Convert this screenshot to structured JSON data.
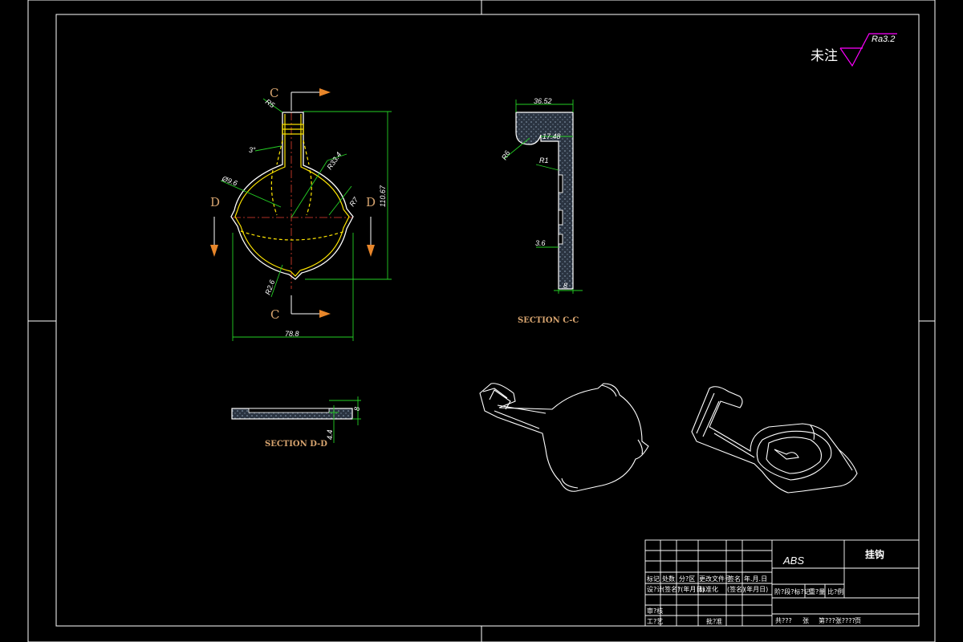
{
  "annotations": {
    "surface_note": "未注",
    "roughness": "Ra3.2"
  },
  "main_view": {
    "section_letters": [
      "C",
      "C",
      "D",
      "D"
    ],
    "dims": {
      "width": "78.8",
      "height": "110.67",
      "r334": "R33.4",
      "r7": "R7",
      "r26": "R2.6",
      "dia": "Ø9.6",
      "angle": "3°",
      "r_top": "R5"
    }
  },
  "section_cc": {
    "label": "SECTION C-C",
    "dims": {
      "width": "36.52",
      "inner": "17.48",
      "r6": "R6",
      "r1": "R1",
      "t36": "3.6",
      "t8": "8"
    }
  },
  "section_dd": {
    "label": "SECTION D-D",
    "dims": {
      "d8": "8",
      "d44": "4.4"
    }
  },
  "title_block": {
    "material": "ABS",
    "part_name": "挂钩",
    "row_labels": [
      "标记",
      "处数",
      "分?区",
      "更改文件号",
      "签名",
      "年.月.日"
    ],
    "row2_labels": [
      "设?计",
      "(签名)",
      "?(年月日)",
      "标准化",
      "(签名)",
      "(年月日)"
    ],
    "row3_labels": [
      "审?核",
      "工?艺",
      "批?准"
    ],
    "mid_labels": [
      "阶?段?标?记",
      "重?量",
      "比?例"
    ],
    "bottom_labels": [
      "共???",
      "张",
      "第???张????",
      "页"
    ]
  }
}
